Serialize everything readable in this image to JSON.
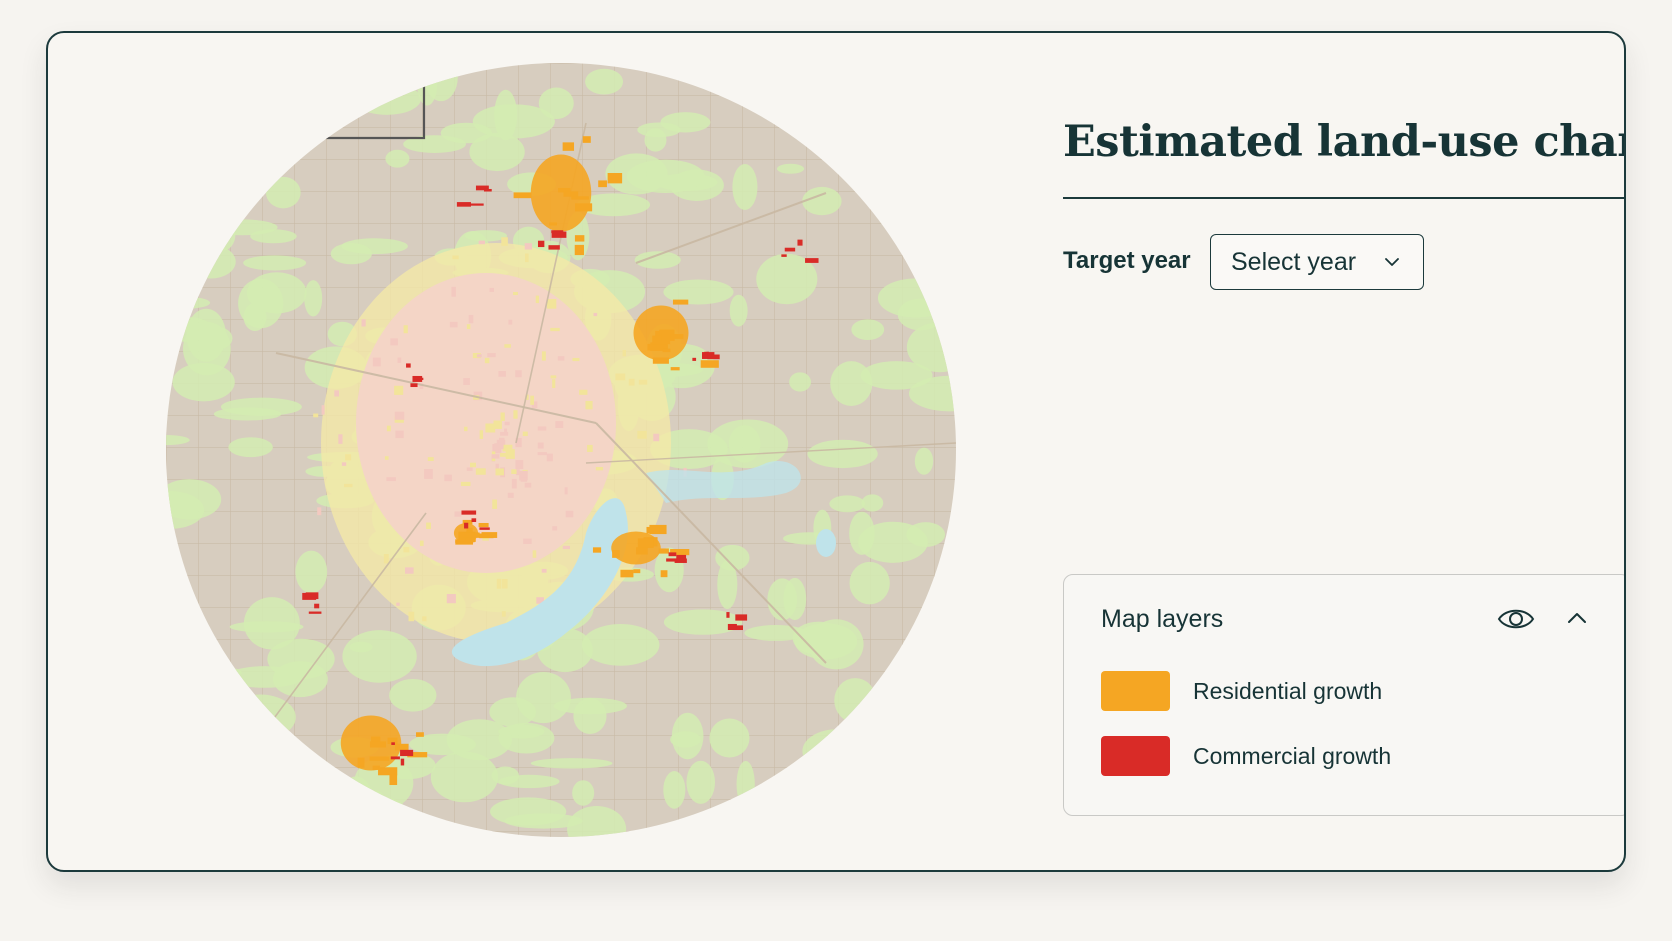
{
  "panel": {
    "title": "Estimated land-use change",
    "target_year": {
      "label": "Target year",
      "select_value": "Select year"
    }
  },
  "layers": {
    "title": "Map layers",
    "items": [
      {
        "label": "Residential growth",
        "color": "#f5a623"
      },
      {
        "label": "Commercial growth",
        "color": "#d92b27"
      }
    ]
  },
  "map": {
    "base_color": "#d7cdbf",
    "vegetation_color": "#d4ecb2",
    "urban_color": "#f3d4c7",
    "water_color": "#bfe3ea",
    "road_color": "#c9b8a2"
  }
}
